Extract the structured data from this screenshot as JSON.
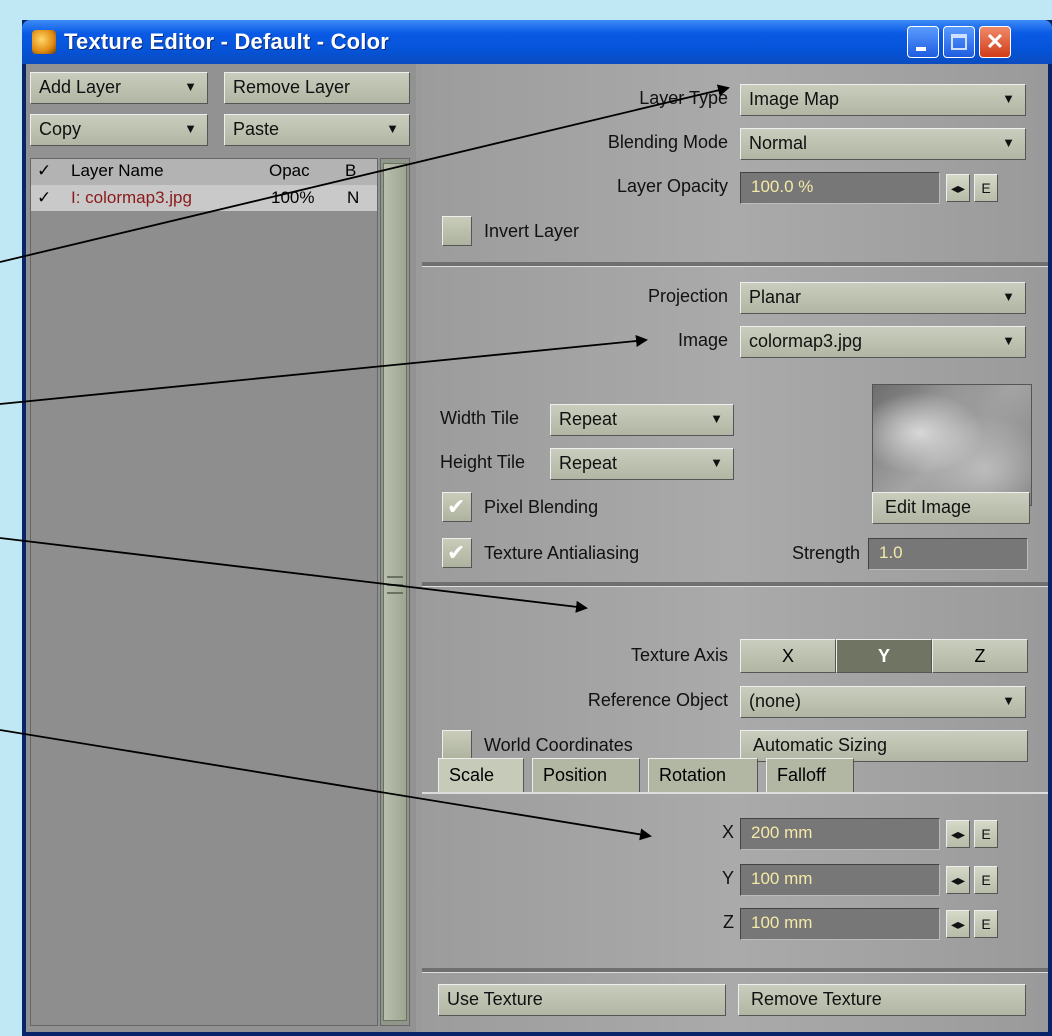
{
  "window": {
    "title": "Texture Editor - Default - Color"
  },
  "left": {
    "add_layer": "Add Layer",
    "remove_layer": "Remove Layer",
    "copy": "Copy",
    "paste": "Paste",
    "columns": {
      "check": "✓",
      "name": "Layer Name",
      "opacity": "Opac",
      "blend": "B"
    },
    "rows": [
      {
        "check": "✓",
        "name": "I: colormap3.jpg",
        "opacity": "100%",
        "blend": "N"
      }
    ]
  },
  "layer": {
    "type_label": "Layer Type",
    "type_value": "Image Map",
    "blend_label": "Blending Mode",
    "blend_value": "Normal",
    "opacity_label": "Layer Opacity",
    "opacity_value": "100.0 %",
    "invert_label": "Invert Layer",
    "envelope_label": "E"
  },
  "image": {
    "projection_label": "Projection",
    "projection_value": "Planar",
    "image_label": "Image",
    "image_value": "colormap3.jpg",
    "width_tile_label": "Width Tile",
    "width_tile_value": "Repeat",
    "height_tile_label": "Height Tile",
    "height_tile_value": "Repeat",
    "pixel_blending": "Pixel Blending",
    "antialias": "Texture Antialiasing",
    "strength_label": "Strength",
    "strength_value": "1.0",
    "edit_image": "Edit Image"
  },
  "axis": {
    "label": "Texture Axis",
    "x": "X",
    "y": "Y",
    "z": "Z",
    "selected": "Y",
    "ref_label": "Reference Object",
    "ref_value": "(none)",
    "world": "World Coordinates",
    "auto_size": "Automatic Sizing"
  },
  "tabs": [
    "Scale",
    "Position",
    "Rotation",
    "Falloff"
  ],
  "scale": {
    "x_label": "X",
    "x_value": "200 mm",
    "y_label": "Y",
    "y_value": "100 mm",
    "z_label": "Z",
    "z_value": "100 mm"
  },
  "footer": {
    "use": "Use Texture",
    "remove": "Remove Texture"
  },
  "colors": {
    "titlebar": "#0a5ae6",
    "panel": "#9a9a9a",
    "field_text": "#f4e9a6",
    "background": "#bfe8f4"
  }
}
